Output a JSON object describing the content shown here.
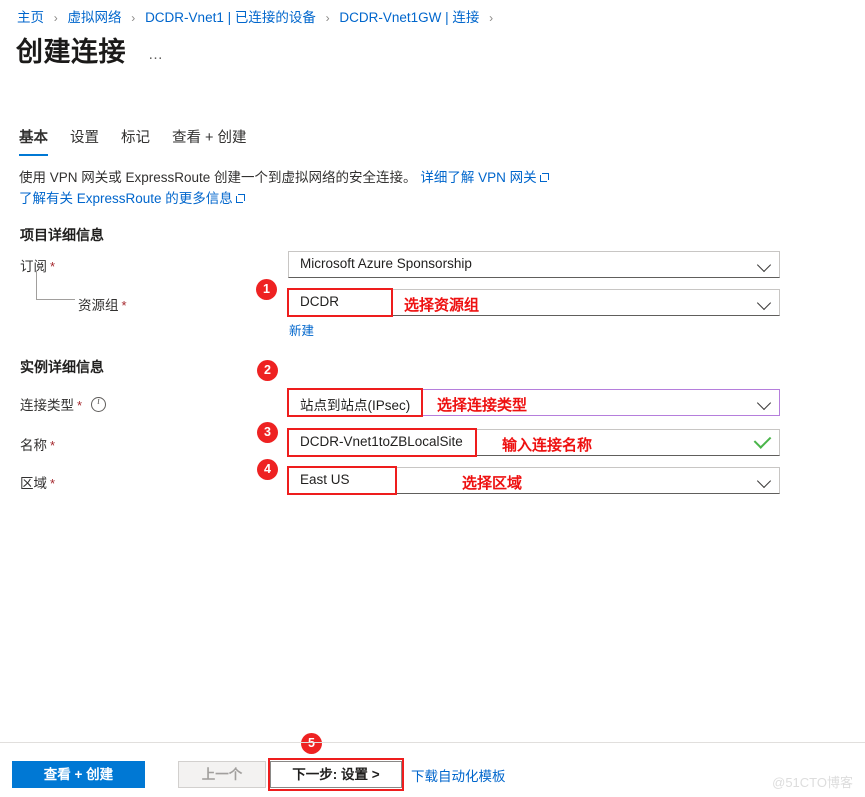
{
  "breadcrumb": {
    "items": [
      {
        "label": "主页"
      },
      {
        "label": "虚拟网络"
      },
      {
        "label": "DCDR-Vnet1 | 已连接的设备"
      },
      {
        "label": "DCDR-Vnet1GW | 连接"
      }
    ],
    "separator": "›"
  },
  "header": {
    "title": "创建连接",
    "more_label": "…"
  },
  "tabs": [
    {
      "label": "基本",
      "active": true
    },
    {
      "label": "设置",
      "active": false
    },
    {
      "label": "标记",
      "active": false
    },
    {
      "label": "查看 + 创建",
      "active": false
    }
  ],
  "description": {
    "text": "使用 VPN 网关或 ExpressRoute 创建一个到虚拟网络的安全连接。",
    "link1": "详细了解 VPN 网关",
    "link2": "了解有关 ExpressRoute 的更多信息"
  },
  "sections": {
    "project": {
      "heading": "项目详细信息",
      "fields": {
        "subscription": {
          "label": "订阅",
          "required": "*",
          "value": "Microsoft Azure Sponsorship",
          "icon": "chevron-down-icon"
        },
        "resource_group": {
          "label": "资源组",
          "required": "*",
          "value": "DCDR",
          "icon": "chevron-down-icon",
          "new_link": "新建"
        }
      }
    },
    "instance": {
      "heading": "实例详细信息",
      "fields": {
        "connection_type": {
          "label": "连接类型",
          "required": "*",
          "info_icon": "info-icon",
          "value": "站点到站点(IPsec)",
          "icon": "chevron-down-icon"
        },
        "name": {
          "label": "名称",
          "required": "*",
          "value": "DCDR-Vnet1toZBLocalSite",
          "icon": "check-icon"
        },
        "region": {
          "label": "区域",
          "required": "*",
          "value": "East US",
          "icon": "chevron-down-icon"
        }
      }
    }
  },
  "annotations": {
    "color": "#ee1111",
    "items": [
      {
        "badge": "1",
        "text": "选择资源组"
      },
      {
        "badge": "2",
        "text": "选择连接类型"
      },
      {
        "badge": "3",
        "text": "输入连接名称"
      },
      {
        "badge": "4",
        "text": "选择区域"
      },
      {
        "badge": "5",
        "text": ""
      }
    ]
  },
  "footer": {
    "review_create": "查看 + 创建",
    "previous": "上一个",
    "next": "下一步: 设置 >",
    "download_template": "下载自动化模板"
  },
  "watermark": "@51CTO博客"
}
